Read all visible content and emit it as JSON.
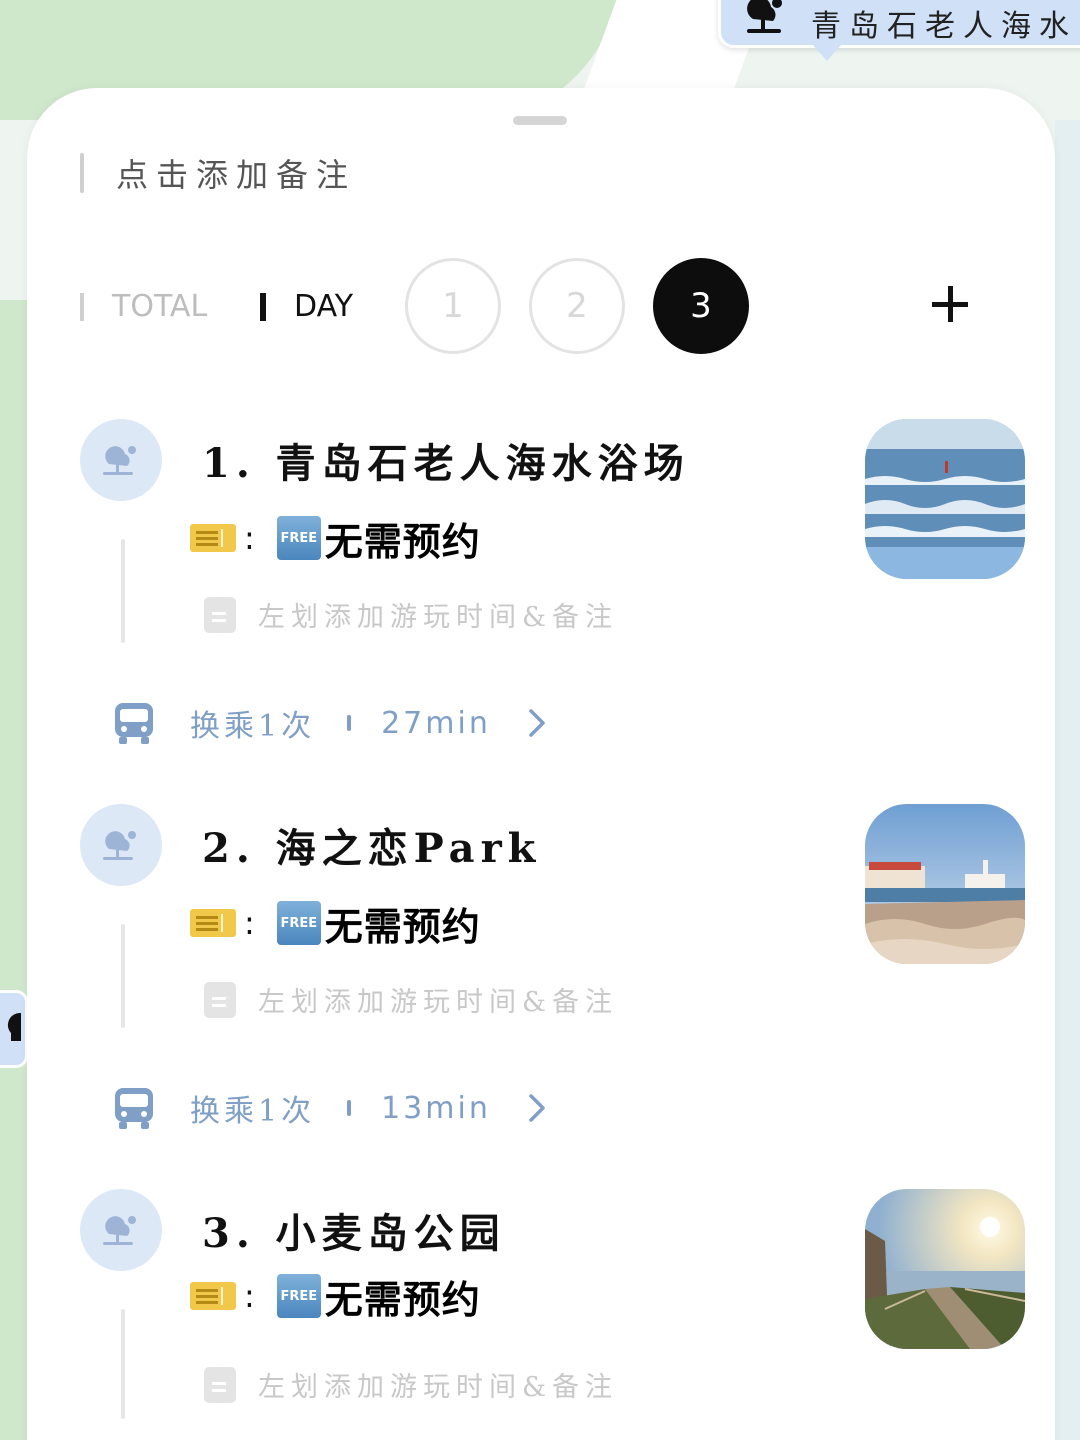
{
  "map": {
    "callout_label": "青岛石老人海水",
    "callout_icon": "park-pin-icon"
  },
  "note": {
    "placeholder": "点击添加备注"
  },
  "tabs": {
    "total_label": "TOTAL",
    "day_label": "DAY",
    "days": [
      "1",
      "2",
      "3"
    ],
    "active_day": "3",
    "add_icon": "plus-icon"
  },
  "places": [
    {
      "name": "1. 青岛石老人海水浴场",
      "ticket_colon": ":",
      "free_badge": "FREE",
      "reservation": "无需预约",
      "memo_hint": "左划添加游玩时间&备注",
      "thumb": "beach-photo"
    },
    {
      "name": "2. 海之恋Park",
      "ticket_colon": ":",
      "free_badge": "FREE",
      "reservation": "无需预约",
      "memo_hint": "左划添加游玩时间&备注",
      "thumb": "seaside-rocks-photo"
    },
    {
      "name": "3. 小麦岛公园",
      "ticket_colon": ":",
      "free_badge": "FREE",
      "reservation": "无需预约",
      "memo_hint": "左划添加游玩时间&备注",
      "thumb": "sunset-path-photo"
    }
  ],
  "transits": [
    {
      "transfers": "换乘1次",
      "duration": "27min"
    },
    {
      "transfers": "换乘1次",
      "duration": "13min"
    }
  ],
  "colors": {
    "accent_blue": "#7f9fc7",
    "active_day_bg": "#0d0d0d",
    "icon_circle_bg": "#dde8f6",
    "ticket_yellow": "#f2c84b"
  }
}
